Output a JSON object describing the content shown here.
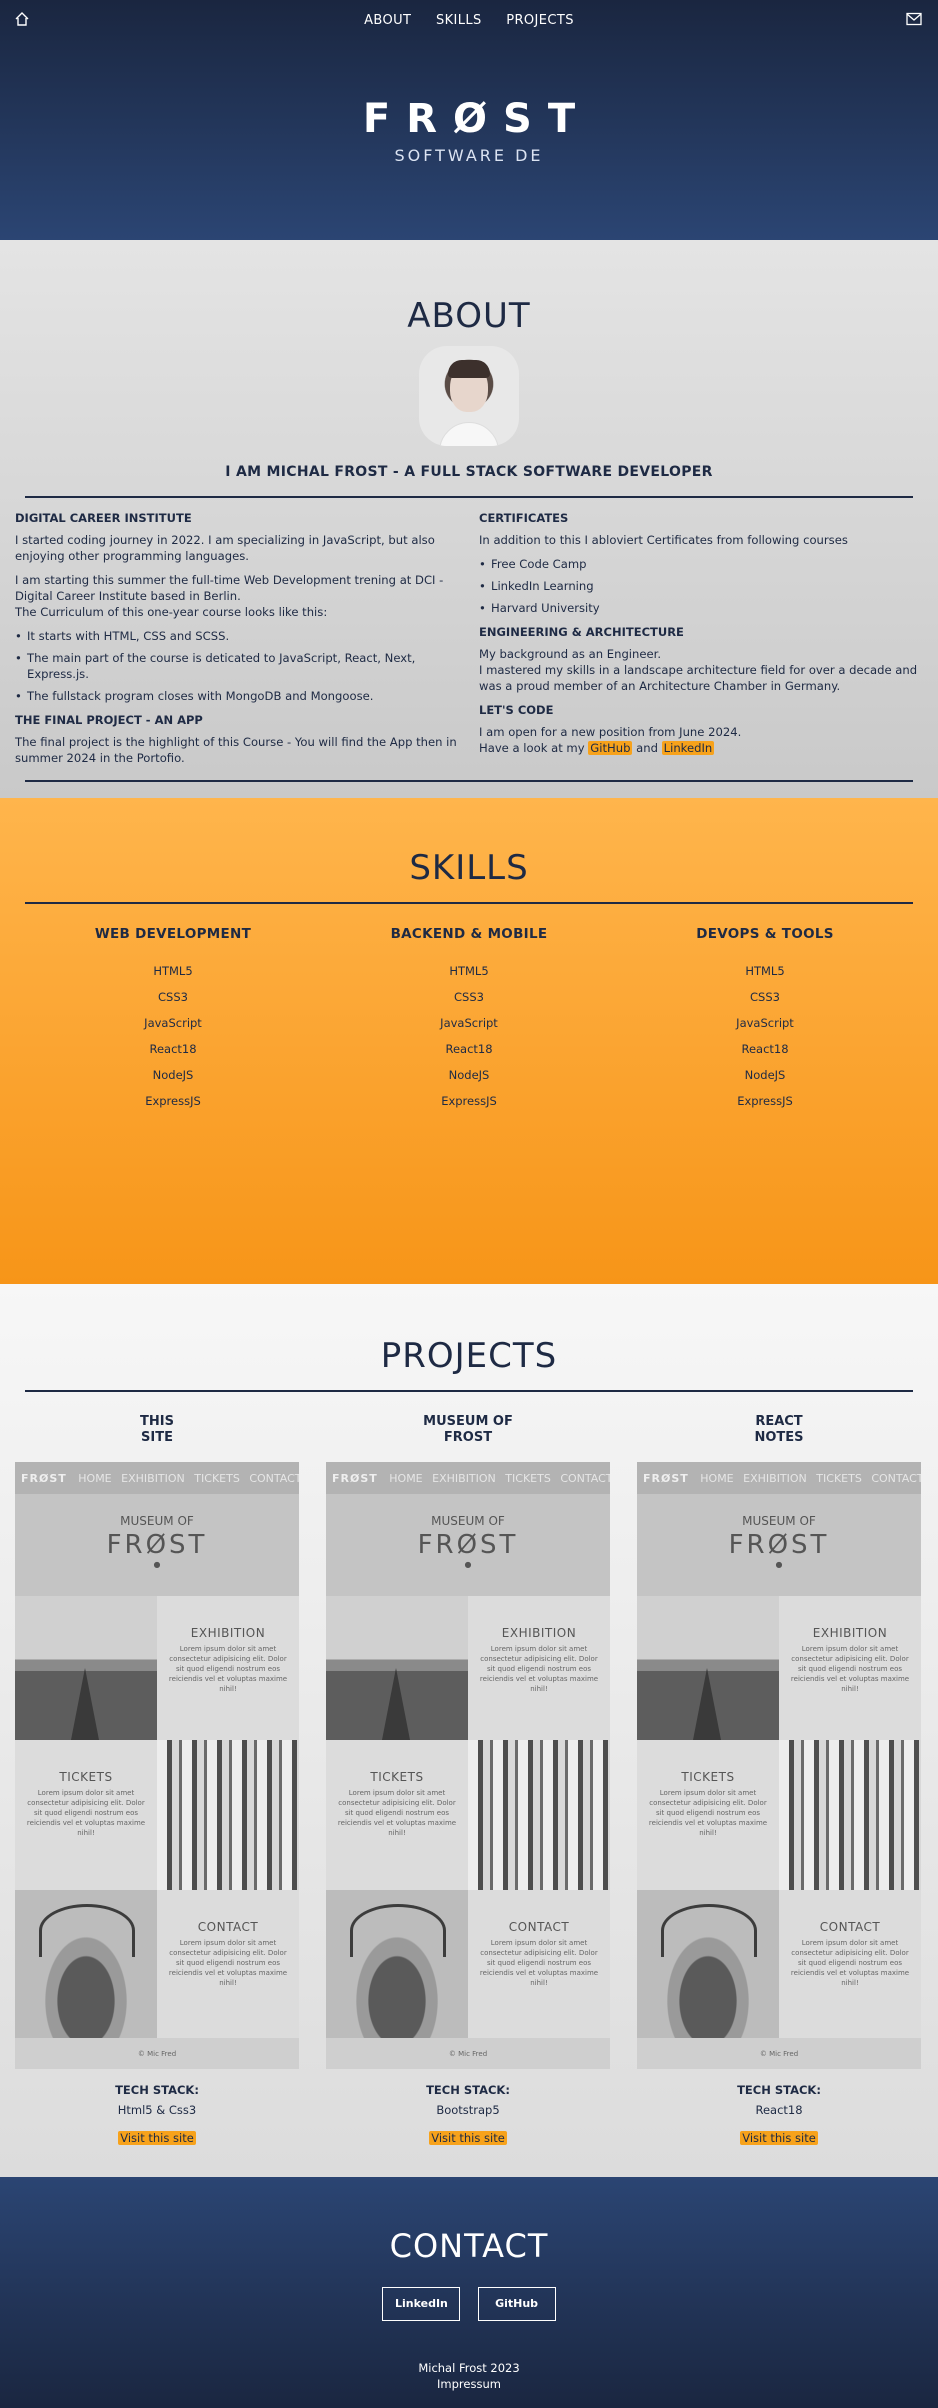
{
  "nav": {
    "links": [
      "ABOUT",
      "SKILLS",
      "PROJECTS"
    ],
    "home_icon": "home-icon",
    "mail_icon": "mail-icon"
  },
  "hero": {
    "brand": "FRØST",
    "tagline": "SOFTWARE DE"
  },
  "about": {
    "title": "ABOUT",
    "heading": "I AM MICHAL FROST - A FULL STACK SOFTWARE DEVELOPER",
    "left": {
      "h1": "DIGITAL CAREER INSTITUTE",
      "p1": "I started coding journey in 2022. I am specializing in JavaScript, but also enjoying other programming languages.",
      "p2a": "I am starting this summer the full-time Web Development trening at DCI - Digital Career Institute based in Berlin.",
      "p2b": "The Curriculum of this one-year course looks like this:",
      "bullets": [
        "It starts with HTML, CSS and SCSS.",
        "The main part of the course is deticated to JavaScript, React, Next, Express.js.",
        "The fullstack program closes with MongoDB and Mongoose."
      ],
      "h2": "THE FINAL PROJECT - AN APP",
      "p3": "The final project is the highlight of this Course - You will find the App then in summer 2024 in the Portofio."
    },
    "right": {
      "h1": "CERTIFICATES",
      "p1": "In addition to this I abloviert Certificates from following courses",
      "bullets": [
        "Free Code Camp",
        "LinkedIn Learning",
        "Harvard University"
      ],
      "h2": "ENGINEERING & ARCHITECTURE",
      "p2a": "My background as an Engineer.",
      "p2b": "I mastered my skills in a landscape architecture field for over a decade and was a proud member of an Architecture Chamber in Germany.",
      "h3": "LET'S CODE",
      "p3a": "I am open for a new position from June 2024.",
      "p3b_prefix": "Have a look at my",
      "github": "GitHub",
      "and": "and",
      "linkedin": "LinkedIn"
    }
  },
  "skills": {
    "title": "SKILLS",
    "columns": [
      {
        "title": "WEB DEVELOPMENT",
        "items": [
          "HTML5",
          "CSS3",
          "JavaScript",
          "React18",
          "NodeJS",
          "ExpressJS"
        ]
      },
      {
        "title": "BACKEND & MOBILE",
        "items": [
          "HTML5",
          "CSS3",
          "JavaScript",
          "React18",
          "NodeJS",
          "ExpressJS"
        ]
      },
      {
        "title": "DEVOPS & TOOLS",
        "items": [
          "HTML5",
          "CSS3",
          "JavaScript",
          "React18",
          "NodeJS",
          "ExpressJS"
        ]
      }
    ]
  },
  "projects": {
    "title": "PROJECTS",
    "preview": {
      "nav_brand": "FRØST",
      "nav_items": [
        "HOME",
        "EXHIBITION",
        "TICKETS",
        "CONTACT"
      ],
      "hero_small": "MUSEUM OF",
      "hero_big": "FRØST",
      "hero_dot": "●",
      "exhibition_title": "EXHIBITION",
      "tickets_title": "TICKETS",
      "contact_title": "CONTACT",
      "lorem": "Lorem ipsum dolor sit amet consectetur adipisicing elit. Dolor sit quod eligendi nostrum eos reiciendis vel et voluptas maxime nihil!",
      "footer": "© Mic Fred"
    },
    "tech_label": "TECH STACK:",
    "visit_label": "Visit this site",
    "items": [
      {
        "title_l1": "THIS",
        "title_l2": "SITE",
        "tech": "Html5 & Css3"
      },
      {
        "title_l1": "MUSEUM OF",
        "title_l2": "FROST",
        "tech": "Bootstrap5"
      },
      {
        "title_l1": "REACT",
        "title_l2": "NOTES",
        "tech": "React18"
      }
    ]
  },
  "contact": {
    "title": "CONTACT",
    "buttons": [
      "LinkedIn",
      "GitHub"
    ],
    "footer_name": "Michal Frost 2023",
    "footer_link": "Impressum"
  },
  "colors": {
    "navy": "#1e2a44",
    "orange": "#f79518",
    "highlight": "#f7a21b"
  }
}
